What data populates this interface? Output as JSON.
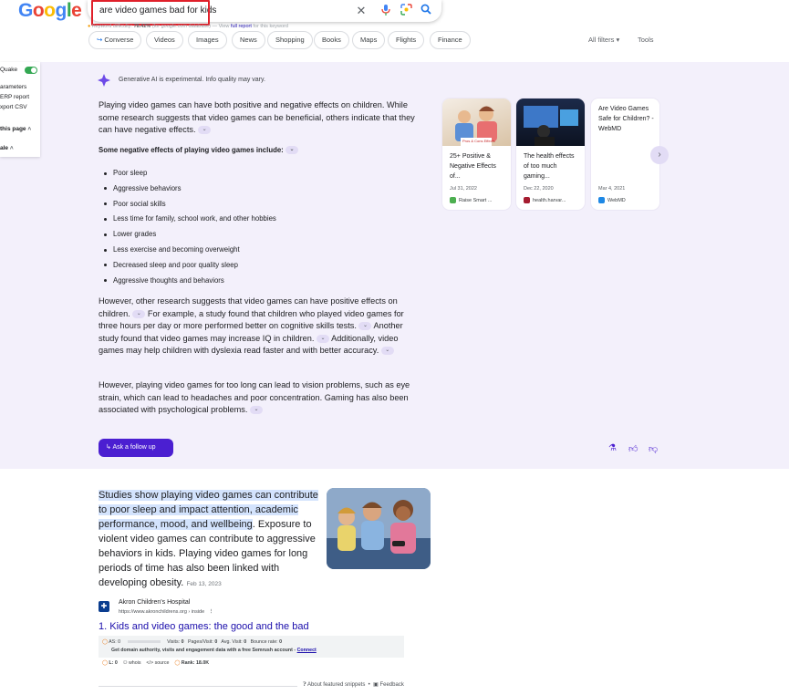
{
  "header": {
    "logo_letters": [
      "G",
      "o",
      "o",
      "g",
      "l",
      "e"
    ],
    "logo_colors": [
      "#4285f4",
      "#ea4335",
      "#fbbc05",
      "#4285f4",
      "#34a853",
      "#ea4335"
    ],
    "query": "are video games bad for kids",
    "keyword_prefix": "Keyword difficulty:",
    "keyword_value": "78.42%",
    "keyword_suffix": "(for google.com database) — View",
    "keyword_link": "full report",
    "keyword_tail": "for this keyword",
    "icons": [
      "close-icon",
      "mic-icon",
      "lens-icon",
      "search-icon"
    ]
  },
  "tabs": [
    "Converse",
    "Videos",
    "Images",
    "News",
    "Shopping",
    "Books",
    "Maps",
    "Flights",
    "Finance"
  ],
  "all_filters": "All filters",
  "tools": "Tools",
  "sidebar": {
    "quake": "Quake",
    "parameters": "arameters",
    "serp_report": "ERP report",
    "export_csv": "xport CSV",
    "this_page": "this page",
    "scale": "ale"
  },
  "ai_overview": {
    "notice": "Generative AI is experimental. Info quality may vary.",
    "intro": "Playing video games can have both positive and negative effects on children. While some research suggests that video games can be beneficial, others indicate that they can have negative effects.",
    "neg_heading": "Some negative effects of playing video games include:",
    "negatives": [
      "Poor sleep",
      "Aggressive behaviors",
      "Poor social skills",
      "Less time for family, school work, and other hobbies",
      "Lower grades",
      "Less exercise and becoming overweight",
      "Decreased sleep and poor quality sleep",
      "Aggressive thoughts and behaviors"
    ],
    "positive_1": "However, other research suggests that video games can have positive effects on children.",
    "positive_2": "For example, a study found that children who played video games for three hours per day or more performed better on cognitive skills tests.",
    "positive_3": "Another study found that video games may increase IQ in children.",
    "positive_4": "Additionally, video games may help children with dyslexia read faster and with better accuracy.",
    "closing": "However, playing video games for too long can lead to vision problems, such as eye strain, which can lead to headaches and poor concentration. Gaming has also been associated with psychological problems.",
    "follow_up": "Ask a follow up",
    "cards": [
      {
        "title": "25+ Positive & Negative Effects of...",
        "date": "Jul 31, 2022",
        "source": "Raise Smart ...",
        "fav_color": "#4caf50"
      },
      {
        "title": "The health effects of too much gaming...",
        "date": "Dec 22, 2020",
        "source": "health.harvar...",
        "fav_color": "#a51c30"
      },
      {
        "title": "Are Video Games Safe for Children? - WebMD",
        "date": "Mar 4, 2021",
        "source": "WebMD",
        "fav_color": "#1e88e5"
      }
    ],
    "card1_caption": "Pros & Cons Effects"
  },
  "snippet": {
    "highlight": "Studies show playing video games can contribute to poor sleep and impact attention, academic performance, mood, and wellbeing",
    "rest": ". Exposure to violent video games can contribute to aggressive behaviors in kids. Playing video games for long periods of time has also been linked with developing obesity.",
    "date": "Feb 13, 2023",
    "site": "Akron Children's Hospital",
    "url": "https://www.akronchildrens.org › inside",
    "result_num": "1.",
    "result_title": "Kids and video games: the good and the bad",
    "seo_as": "AS: 0",
    "seo_visits": "Visits:",
    "seo_visits_val": "0",
    "seo_pages": "Pages/Visit:",
    "seo_pages_val": "0",
    "seo_avg": "Avg. Visit:",
    "seo_avg_val": "0",
    "seo_bounce": "Bounce rate:",
    "seo_bounce_val": "0",
    "seo_promo": "Get domain authority, visits and engagement data with a free Semrush account -",
    "seo_connect": "Connect",
    "seo_l": "L: 0",
    "seo_whois": "whois",
    "seo_source": "source",
    "seo_rank": "Rank: 18.0K",
    "about": "About featured snippets",
    "feedback": "Feedback"
  }
}
